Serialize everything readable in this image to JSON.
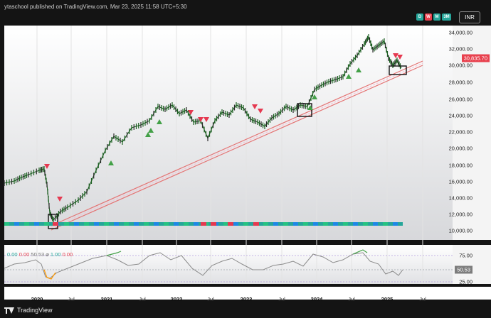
{
  "publisher_text": "ytaschool published on TradingView.com, Mar 23, 2025 11:58 UTC+5:30",
  "timeframe_buttons": [
    {
      "label": "D",
      "color": "#26a69a"
    },
    {
      "label": "W",
      "color": "#e8414e"
    },
    {
      "label": "M",
      "color": "#26a69a"
    },
    {
      "label": "3M",
      "color": "#26a69a"
    }
  ],
  "currency": "INR",
  "price_axis": {
    "labels": [
      "34,000.00",
      "32,000.00",
      "30,000.00",
      "28,000.00",
      "26,000.00",
      "24,000.00",
      "22,000.00",
      "20,000.00",
      "18,000.00",
      "16,000.00",
      "14,000.00",
      "12,000.00",
      "10,000.00"
    ],
    "current_price": "30,835.70",
    "current_price_color": "#e8414e"
  },
  "rsi": {
    "legend": [
      {
        "text": "0.00",
        "color": "#26a69a"
      },
      {
        "text": "0.00",
        "color": "#e8414e"
      },
      {
        "text": "50.53",
        "color": "#777777"
      },
      {
        "text": "⌀",
        "color": "#555555"
      },
      {
        "text": "1.00",
        "color": "#26a69a"
      },
      {
        "text": "0.00",
        "color": "#e8414e"
      }
    ],
    "levels": [
      "75.00",
      "25.00"
    ],
    "current_value": "50.53"
  },
  "time_axis": [
    {
      "label": "2020",
      "bold": true
    },
    {
      "label": "Jul",
      "bold": false
    },
    {
      "label": "2021",
      "bold": true
    },
    {
      "label": "Jul",
      "bold": false
    },
    {
      "label": "2022",
      "bold": true
    },
    {
      "label": "Jul",
      "bold": false
    },
    {
      "label": "2023",
      "bold": true
    },
    {
      "label": "Jul",
      "bold": false
    },
    {
      "label": "2024",
      "bold": true
    },
    {
      "label": "Jul",
      "bold": false
    },
    {
      "label": "2025",
      "bold": true
    },
    {
      "label": "Jul",
      "bold": false
    }
  ],
  "brand_name": "TradingView",
  "icons": {
    "brand": "tradingview-logo-icon"
  }
}
